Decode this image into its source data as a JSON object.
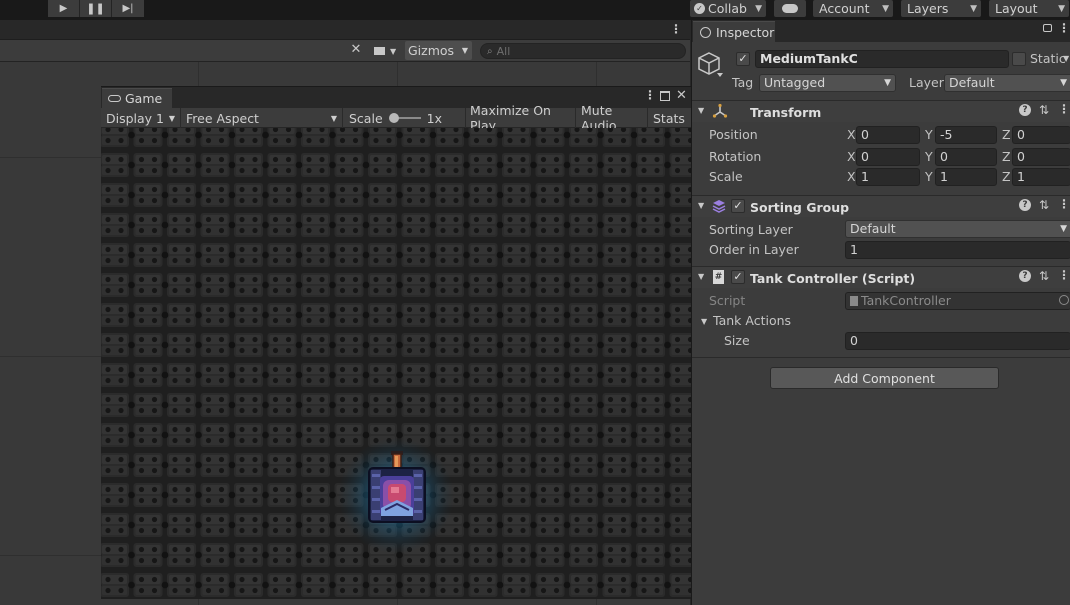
{
  "toolbar": {
    "collab_label": "Collab",
    "account_label": "Account",
    "layers_label": "Layers",
    "layout_label": "Layout"
  },
  "scene_toolbar": {
    "gizmos_label": "Gizmos",
    "search_placeholder": "All"
  },
  "game_view": {
    "tab_label": "Game",
    "display_label": "Display 1",
    "aspect_label": "Free Aspect",
    "scale_label": "Scale",
    "scale_value": "1x",
    "maximize_label": "Maximize On Play",
    "mute_label": "Mute Audio",
    "stats_label": "Stats"
  },
  "inspector": {
    "tab_label": "Inspector",
    "object_name": "MediumTankC",
    "static_label": "Static",
    "tag_label": "Tag",
    "tag_value": "Untagged",
    "layer_label": "Layer",
    "layer_value": "Default",
    "transform": {
      "title": "Transform",
      "position_label": "Position",
      "rotation_label": "Rotation",
      "scale_label": "Scale",
      "x_label": "X",
      "y_label": "Y",
      "z_label": "Z",
      "position": {
        "x": "0",
        "y": "-5",
        "z": "0"
      },
      "rotation": {
        "x": "0",
        "y": "0",
        "z": "0"
      },
      "scale": {
        "x": "1",
        "y": "1",
        "z": "1"
      }
    },
    "sorting_group": {
      "title": "Sorting Group",
      "sorting_layer_label": "Sorting Layer",
      "sorting_layer_value": "Default",
      "order_label": "Order in Layer",
      "order_value": "1"
    },
    "tank_controller": {
      "title": "Tank Controller (Script)",
      "script_label": "Script",
      "script_value": "TankController",
      "actions_label": "Tank Actions",
      "size_label": "Size",
      "size_value": "0"
    },
    "add_component_label": "Add Component"
  }
}
